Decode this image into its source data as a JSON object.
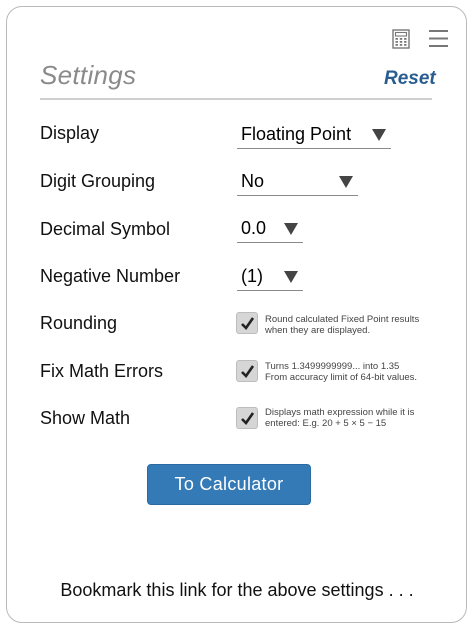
{
  "header": {
    "title": "Settings",
    "reset_label": "Reset",
    "icons": [
      "calculator-icon",
      "hamburger-menu-icon"
    ]
  },
  "settings": {
    "display": {
      "label": "Display",
      "value": "Floating Point"
    },
    "digit_grouping": {
      "label": "Digit Grouping",
      "value": "No"
    },
    "decimal_symbol": {
      "label": "Decimal Symbol",
      "value": "0.0"
    },
    "negative_number": {
      "label": "Negative Number",
      "value": "(1)"
    },
    "rounding": {
      "label": "Rounding",
      "checked": true,
      "hint_line1": "Round calculated Fixed Point results",
      "hint_line2": "when they are displayed."
    },
    "fix_math_errors": {
      "label": "Fix Math Errors",
      "checked": true,
      "hint_line1": "Turns 1.3499999999... into 1.35",
      "hint_line2": "From accuracy limit of 64-bit values."
    },
    "show_math": {
      "label": "Show Math",
      "checked": true,
      "hint_line1": "Displays math expression while it is",
      "hint_line2": "entered: E.g. 20 + 5 × 5 − 15"
    }
  },
  "actions": {
    "to_calculator_label": "To Calculator"
  },
  "footer": {
    "bookmark_text": "Bookmark this link for the above settings . . ."
  },
  "colors": {
    "accent": "#337ab7",
    "reset_text": "#2a5d8f",
    "title_text": "#8a8a8a"
  }
}
